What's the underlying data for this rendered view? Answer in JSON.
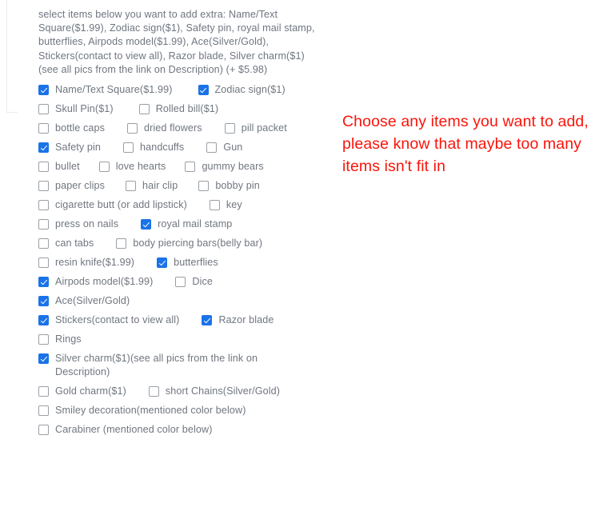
{
  "intro": {
    "text": "select items below you want to add extra:  Name/Text\nSquare($1.99), Zodiac sign($1), Safety pin, royal mail stamp,\nbutterflies, Airpods model($1.99), Ace(Silver/Gold),\nStickers(contact to view all), Razor blade, Silver charm($1)\n(see all pics from the link on Description)  (+ $5.98)"
  },
  "note": {
    "text": "Choose any items you want to add, please know that maybe too many items isn't fit in",
    "color": "#fa140a"
  },
  "colors": {
    "checkbox_checked": "#1a73e8",
    "checkbox_border": "#9aa0a6",
    "label_text": "#70767f",
    "note_text": "#fa140a"
  },
  "options": [
    {
      "items": [
        {
          "label": "Name/Text Square($1.99)",
          "checked": true,
          "gap": 32
        },
        {
          "label": "Zodiac sign($1)",
          "checked": true,
          "gap": 0
        }
      ]
    },
    {
      "items": [
        {
          "label": "Skull Pin($1)",
          "checked": false,
          "gap": 32
        },
        {
          "label": "Rolled bill($1)",
          "checked": false,
          "gap": 0
        }
      ]
    },
    {
      "items": [
        {
          "label": "bottle caps",
          "checked": false,
          "gap": 28
        },
        {
          "label": "dried flowers",
          "checked": false,
          "gap": 28
        },
        {
          "label": "pill packet",
          "checked": false,
          "gap": 0
        }
      ]
    },
    {
      "items": [
        {
          "label": "Safety pin",
          "checked": true,
          "gap": 28
        },
        {
          "label": "handcuffs",
          "checked": false,
          "gap": 28
        },
        {
          "label": "Gun",
          "checked": false,
          "gap": 0
        }
      ]
    },
    {
      "items": [
        {
          "label": "bullet",
          "checked": false,
          "gap": 24
        },
        {
          "label": "love hearts",
          "checked": false,
          "gap": 24
        },
        {
          "label": "gummy bears",
          "checked": false,
          "gap": 0
        }
      ]
    },
    {
      "items": [
        {
          "label": "paper clips",
          "checked": false,
          "gap": 26
        },
        {
          "label": "hair clip",
          "checked": false,
          "gap": 26
        },
        {
          "label": "bobby pin",
          "checked": false,
          "gap": 0
        }
      ]
    },
    {
      "items": [
        {
          "label": "cigarette butt (or add lipstick)",
          "checked": false,
          "gap": 28
        },
        {
          "label": "key",
          "checked": false,
          "gap": 0
        }
      ]
    },
    {
      "items": [
        {
          "label": "press on nails",
          "checked": false,
          "gap": 28
        },
        {
          "label": "royal mail stamp",
          "checked": true,
          "gap": 0
        }
      ]
    },
    {
      "items": [
        {
          "label": "can tabs",
          "checked": false,
          "gap": 28
        },
        {
          "label": "body piercing bars(belly bar)",
          "checked": false,
          "gap": 0
        }
      ]
    },
    {
      "items": [
        {
          "label": "resin knife($1.99)",
          "checked": false,
          "gap": 28
        },
        {
          "label": "butterflies",
          "checked": true,
          "gap": 0
        }
      ]
    },
    {
      "items": [
        {
          "label": "Airpods model($1.99)",
          "checked": true,
          "gap": 28
        },
        {
          "label": "Dice",
          "checked": false,
          "gap": 0
        }
      ]
    },
    {
      "items": [
        {
          "label": "Ace(Silver/Gold)",
          "checked": true,
          "gap": 0
        }
      ]
    },
    {
      "items": [
        {
          "label": "Stickers(contact to view all)",
          "checked": true,
          "gap": 28
        },
        {
          "label": "Razor blade",
          "checked": true,
          "gap": 0
        }
      ]
    },
    {
      "items": [
        {
          "label": "Rings",
          "checked": false,
          "gap": 0
        }
      ]
    },
    {
      "items": [
        {
          "label": "Silver charm($1)(see all pics from the link on\nDescription)",
          "checked": true,
          "gap": 0
        }
      ]
    },
    {
      "items": [
        {
          "label": "Gold charm($1)",
          "checked": false,
          "gap": 28
        },
        {
          "label": "short Chains(Silver/Gold)",
          "checked": false,
          "gap": 0
        }
      ]
    },
    {
      "items": [
        {
          "label": "Smiley decoration(mentioned color below)",
          "checked": false,
          "gap": 0
        }
      ]
    },
    {
      "items": [
        {
          "label": "Carabiner (mentioned color below)",
          "checked": false,
          "gap": 0
        }
      ]
    }
  ]
}
